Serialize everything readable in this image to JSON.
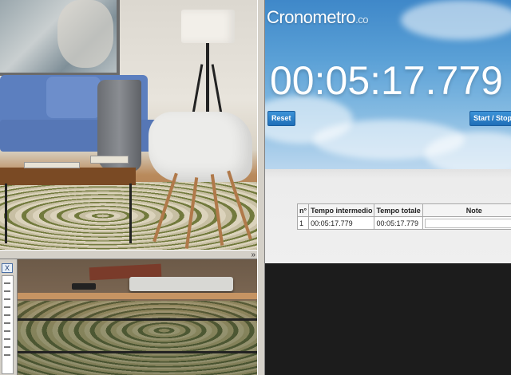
{
  "stopwatch": {
    "brand_name": "Cronometro",
    "brand_tld": ".co",
    "elapsed_time": "00:05:17.779",
    "reset_label": "Reset",
    "start_stop_label": "Start / Stop"
  },
  "laps": {
    "headers": [
      "n°",
      "Tempo intermedio",
      "Tempo totale",
      "Note"
    ],
    "rows": [
      {
        "number": "1",
        "intermediate": "00:05:17.779",
        "total": "00:05:17.779",
        "note": ""
      }
    ]
  },
  "image_viewer": {
    "close_label": "X",
    "collapse_glyph": "»"
  },
  "colors": {
    "sky_blue": "#3f88c9",
    "button_blue": "#1f6fb8"
  }
}
